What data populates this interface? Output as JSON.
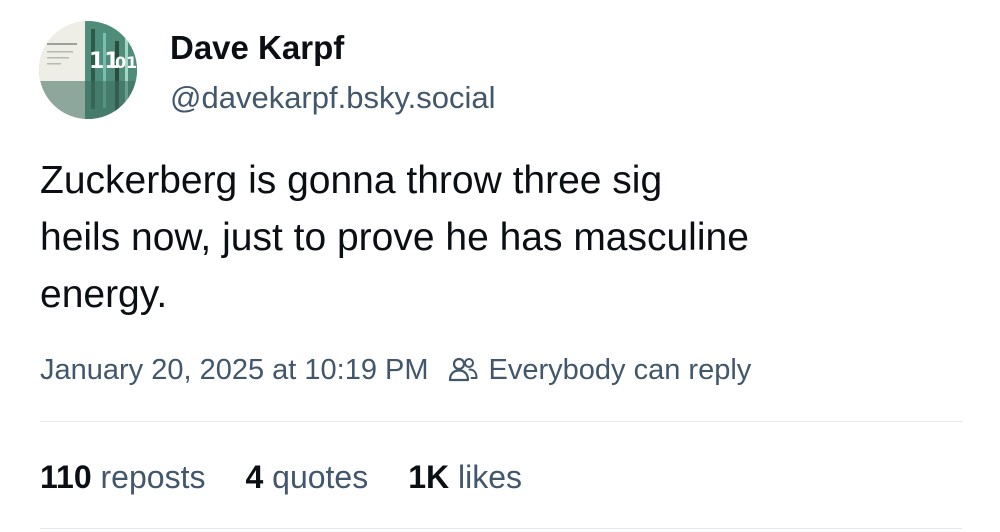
{
  "author": {
    "name": "Dave Karpf",
    "handle": "@davekarpf.bsky.social",
    "avatar": {
      "icon": "profile-photo",
      "texts": [
        "11",
        "01"
      ]
    }
  },
  "post": {
    "lines": [
      "Zuckerberg is gonna throw three sig",
      "heils now, just to prove he has masculine",
      "energy."
    ],
    "timestamp": "January 20, 2025 at 10:19 PM",
    "reply_setting": "Everybody can reply",
    "reply_icon": "people-icon"
  },
  "stats": {
    "reposts": {
      "count": "110",
      "label": "reposts"
    },
    "quotes": {
      "count": "4",
      "label": "quotes"
    },
    "likes": {
      "count": "1K",
      "label": "likes"
    }
  },
  "colors": {
    "text_primary": "#0b0f14",
    "text_secondary": "#42576c",
    "divider": "#e3e8ed",
    "background": "#ffffff"
  }
}
